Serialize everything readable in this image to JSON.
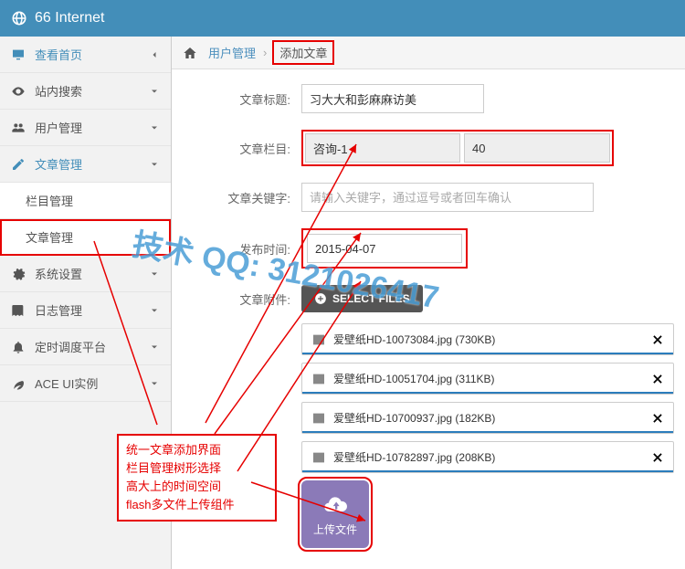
{
  "brand": "66 Internet",
  "sidebar": {
    "items": [
      {
        "label": "查看首页"
      },
      {
        "label": "站内搜索"
      },
      {
        "label": "用户管理"
      },
      {
        "label": "文章管理"
      },
      {
        "label": "系统设置"
      },
      {
        "label": "日志管理"
      },
      {
        "label": "定时调度平台"
      },
      {
        "label": "ACE UI实例"
      }
    ],
    "sub": [
      {
        "label": "栏目管理"
      },
      {
        "label": "文章管理"
      }
    ]
  },
  "breadcrumb": {
    "a": "用户管理",
    "b": "添加文章"
  },
  "form": {
    "titleLabel": "文章标题:",
    "titleValue": "习大大和彭麻麻访美",
    "colLabel": "文章栏目:",
    "colA": "咨询-1",
    "colB": "40",
    "kwLabel": "文章关键字:",
    "kwPlaceholder": "请输入关键字，通过逗号或者回车确认",
    "dateLabel": "发布时间:",
    "dateValue": "2015-04-07",
    "attachLabel": "文章附件:",
    "selectFiles": "SELECT FILES"
  },
  "files": [
    {
      "name": "爱壁纸HD-10073084.jpg (730KB)"
    },
    {
      "name": "爱壁纸HD-10051704.jpg (311KB)"
    },
    {
      "name": "爱壁纸HD-10700937.jpg (182KB)"
    },
    {
      "name": "爱壁纸HD-10782897.jpg (208KB)"
    }
  ],
  "uploadText": "上传文件",
  "note": {
    "l1": "统一文章添加界面",
    "l2": "栏目管理树形选择",
    "l3": "高大上的时间空间",
    "l4": "flash多文件上传组件"
  },
  "watermark": "技术 QQ: 3121026417"
}
